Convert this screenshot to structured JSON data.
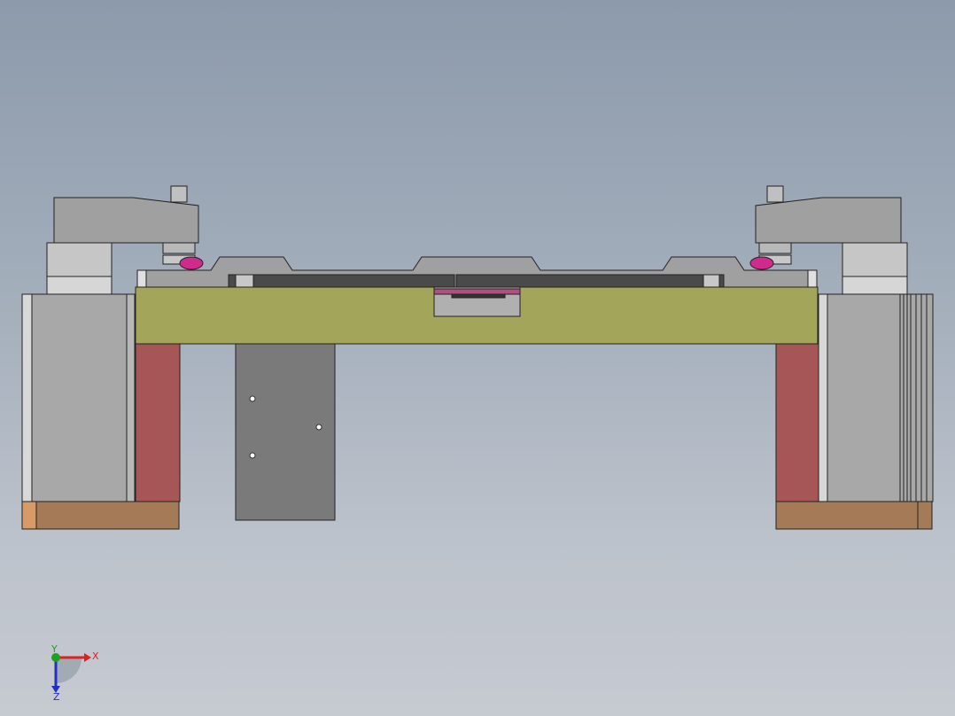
{
  "viewport": {
    "background_top": "#8c9aab",
    "background_bottom": "#c6cad1"
  },
  "colors": {
    "plate_yellow": "#a3a65a",
    "block_grey": "#a8a8a8",
    "pad_red": "#a65656",
    "base_brown": "#a57b57",
    "base_orange": "#d89a66",
    "clamp_grey": "#a0a0a0",
    "knob_magenta": "#d02a8c",
    "dark_slot": "#4a4a4a",
    "hanging_plate": "#7a7a7a"
  },
  "triad": {
    "x_label": "X",
    "y_label": "Y",
    "z_label": "Z",
    "x_color": "#e02020",
    "y_color": "#20a020",
    "z_color": "#2030c0"
  }
}
